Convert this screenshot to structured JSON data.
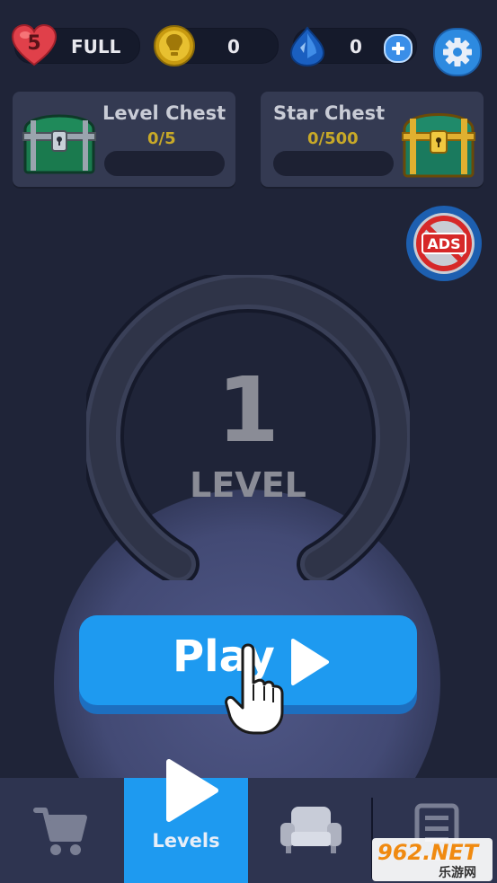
{
  "top_bar": {
    "lives_count": "5",
    "lives_status": "FULL",
    "hints_count": "0",
    "gems_count": "0",
    "icons": [
      "heart-icon",
      "lightbulb-coin-icon",
      "gem-icon",
      "plus-icon",
      "gear-icon"
    ]
  },
  "chests": {
    "level": {
      "title": "Level Chest",
      "progress": "0/5",
      "fraction": 0
    },
    "star": {
      "title": "Star Chest",
      "progress": "0/500",
      "fraction": 0
    }
  },
  "no_ads": {
    "label": "ADS"
  },
  "level_ring": {
    "number": "1",
    "label": "LEVEL"
  },
  "play_button": {
    "label": "Play"
  },
  "bottom_nav": {
    "active": "Levels",
    "levels_label": "Levels",
    "icons": [
      "cart-icon",
      "play-icon",
      "sofa-icon",
      "list-icon"
    ]
  },
  "watermark": {
    "text": "962.NET",
    "subtext": "乐游网"
  },
  "colors": {
    "background": "#1f2438",
    "accent_blue": "#1e9af0",
    "gold": "#c8a928",
    "no_ads_red": "#d62828"
  }
}
